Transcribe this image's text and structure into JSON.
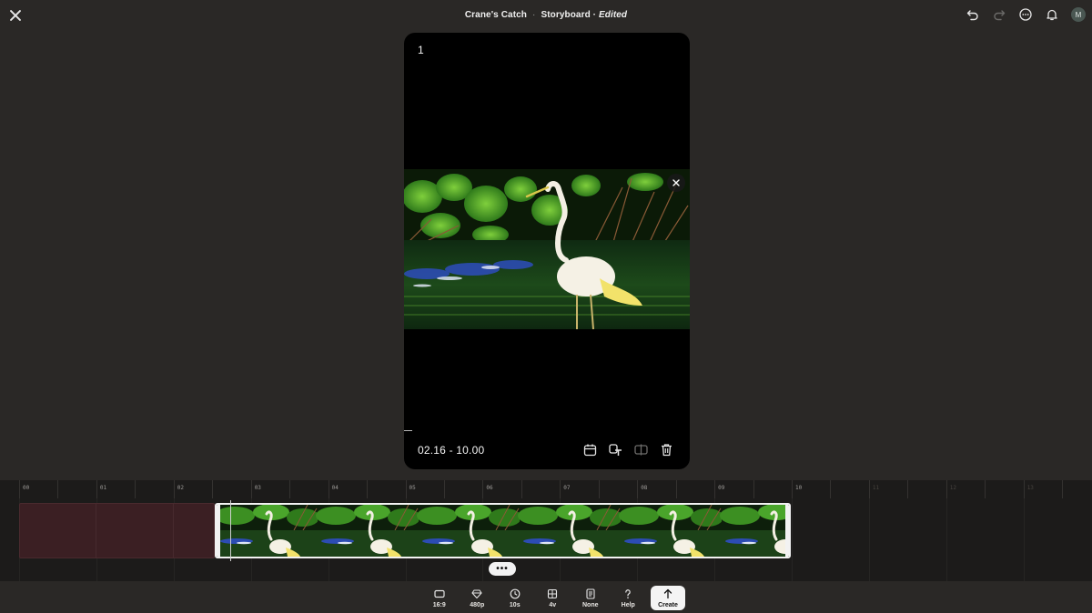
{
  "header": {
    "project_name": "Crane's Catch",
    "separator": "·",
    "view_name": "Storyboard",
    "status": "Edited",
    "avatar_initial": "M"
  },
  "preview": {
    "scene_number": "1",
    "time_range": "02.16 - 10.00",
    "image_subject": "white crane wading in green water in front of leafy bushes"
  },
  "timeline": {
    "ruler_labels": [
      "00",
      "01",
      "02",
      "03",
      "04",
      "05",
      "06",
      "07",
      "08",
      "09",
      "10",
      "11",
      "12",
      "13"
    ],
    "more_label": "•••"
  },
  "toolbar": {
    "items": [
      {
        "label": "16:9",
        "icon": "aspect-ratio-icon"
      },
      {
        "label": "480p",
        "icon": "diamond-quality-icon"
      },
      {
        "label": "10s",
        "icon": "clock-duration-icon"
      },
      {
        "label": "4v",
        "icon": "variations-icon"
      },
      {
        "label": "None",
        "icon": "style-preset-icon"
      },
      {
        "label": "Help",
        "icon": "help-icon"
      },
      {
        "label": "Create",
        "icon": "arrow-up-icon"
      }
    ]
  },
  "colors": {
    "background": "#2a2826",
    "timeline_bg": "#1c1b1a",
    "empty_track": "#3b1f23",
    "accent_white": "#f2f2f2"
  }
}
